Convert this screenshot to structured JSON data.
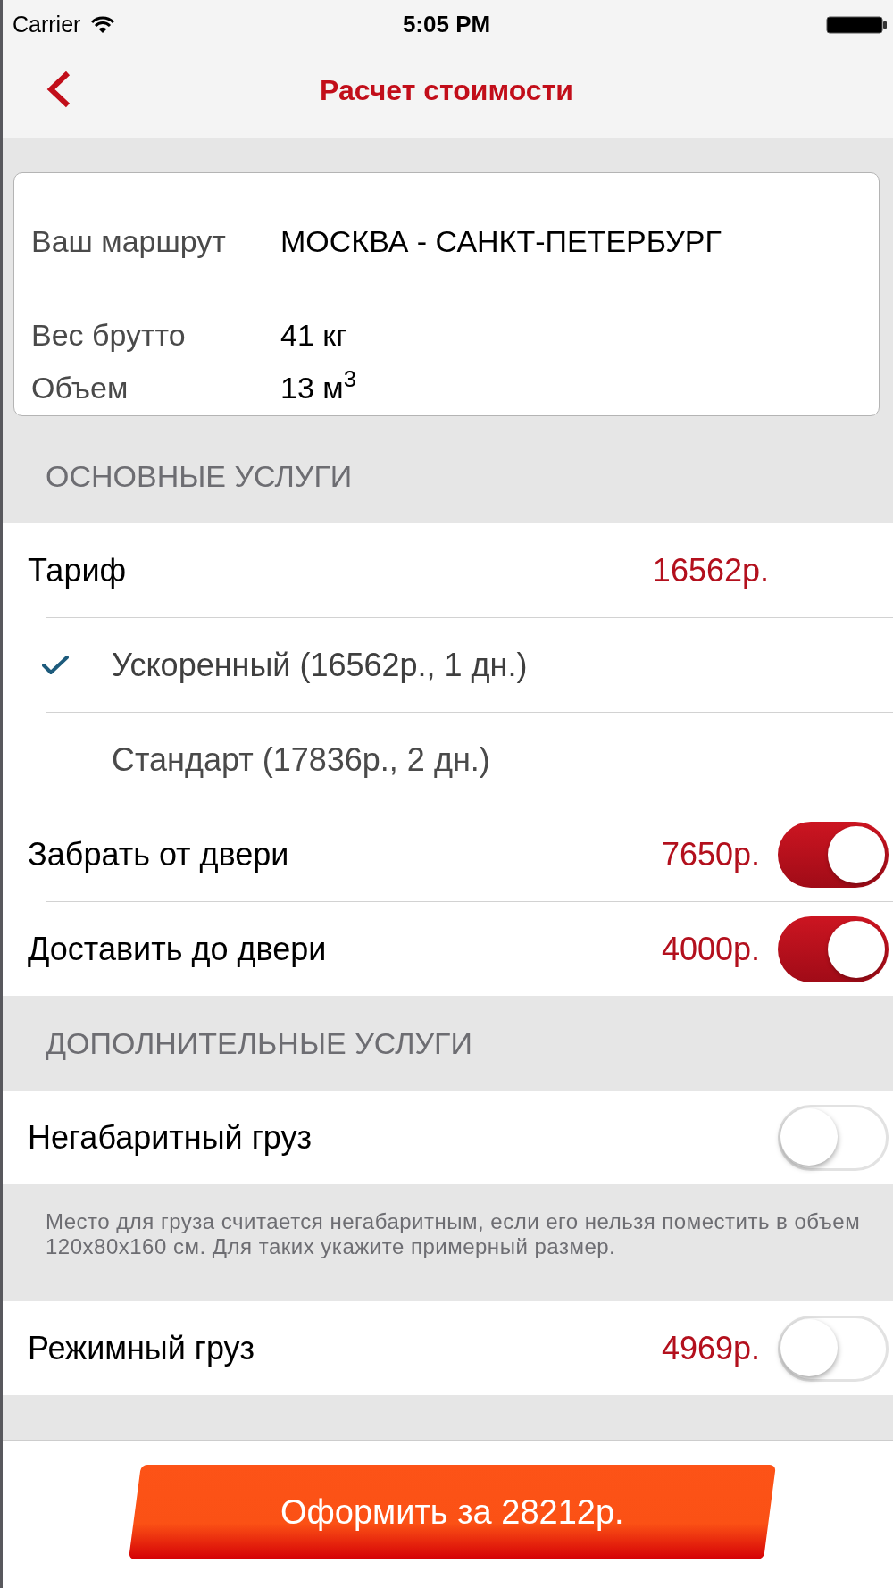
{
  "status_bar": {
    "carrier": "Carrier",
    "time": "5:05 PM"
  },
  "nav_bar": {
    "title": "Расчет стоимости"
  },
  "route_card": {
    "rows": [
      {
        "label": "Ваш маршрут",
        "value": "МОСКВА - САНКТ-ПЕТЕРБУРГ"
      },
      {
        "label": "Вес брутто",
        "value": "41 кг"
      },
      {
        "label": "Объем",
        "value": "13 м$^{3}$"
      }
    ]
  },
  "sections": [
    {
      "header": "ОСНОВНЫЕ УСЛУГИ",
      "rows": [
        {
          "kind": "price",
          "label": "Тариф",
          "price": "16562р."
        },
        {
          "kind": "option",
          "label": "Ускоренный (16562р., 1 дн.)",
          "selected": true
        },
        {
          "kind": "option",
          "label": "Стандарт (17836р., 2 дн.)",
          "selected": false
        },
        {
          "kind": "toggle",
          "label": "Забрать от двери",
          "price": "7650р.",
          "on": true
        },
        {
          "kind": "toggle",
          "label": "Доставить до двери",
          "price": "4000р.",
          "on": true
        }
      ]
    },
    {
      "header": "ДОПОЛНИТЕЛЬНЫЕ УСЛУГИ",
      "rows": [
        {
          "kind": "toggle",
          "label": "Негабаритный груз",
          "on": false
        },
        {
          "kind": "note",
          "text": "Место для груза считается негабаритным, если его нельзя поместить в объем 120x80x160 см. Для таких укажите примерный размер."
        },
        {
          "kind": "toggle",
          "label": "Режимный груз",
          "price": "4969р.",
          "on": false
        }
      ]
    }
  ],
  "order_button": {
    "label": "Оформить за 28212р."
  }
}
